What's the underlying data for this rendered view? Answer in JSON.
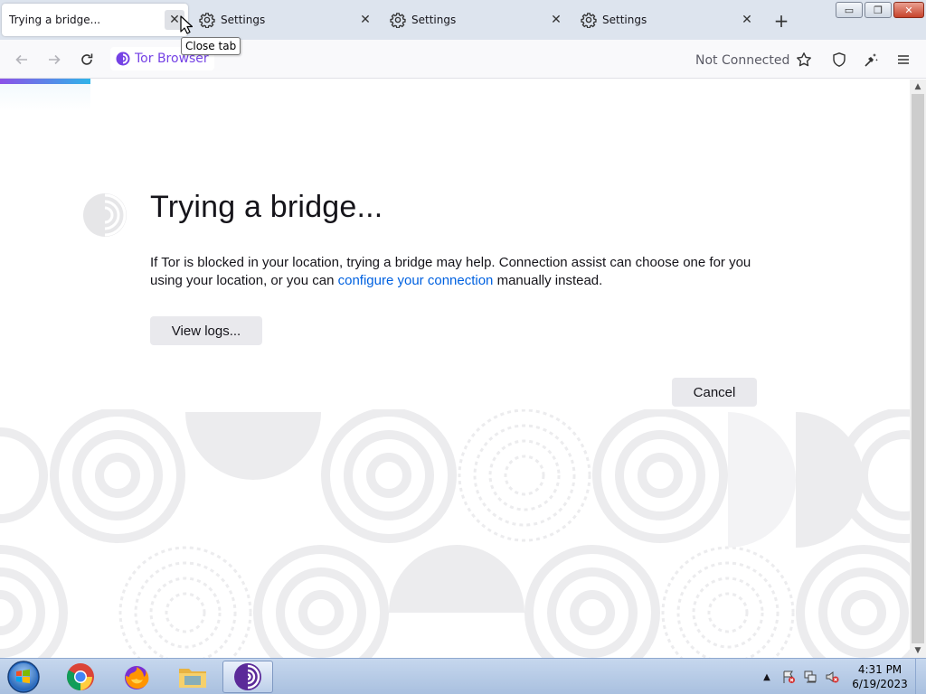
{
  "tabs": [
    {
      "label": "Trying a bridge...",
      "close": "✕"
    },
    {
      "label": "Settings",
      "close": "✕",
      "icon": "gear-icon"
    },
    {
      "label": "Settings",
      "close": "✕",
      "icon": "gear-icon"
    },
    {
      "label": "Settings",
      "close": "✕",
      "icon": "gear-icon"
    }
  ],
  "new_tab": "+",
  "tooltip": "Close tab",
  "window_controls": {
    "minimize": "▭",
    "maximize": "❐",
    "close": "✕"
  },
  "navbar": {
    "identity_label": "Tor Browser",
    "status": "Not Connected"
  },
  "page": {
    "title": "Trying a bridge...",
    "desc_before": "If Tor is blocked in your location, trying a bridge may help. Connection assist can choose one for you using your location, or you can ",
    "desc_link": "configure your connection",
    "desc_after": " manually instead.",
    "view_logs": "View logs...",
    "cancel": "Cancel"
  },
  "scrollbar": {
    "up": "▲",
    "down": "▼"
  },
  "taskbar": {
    "clock_time": "4:31 PM",
    "clock_date": "6/19/2023",
    "tray_chevron": "▲"
  },
  "colors": {
    "accent": "#7542e5",
    "link": "#0061e0",
    "progress_start": "#8c52e8",
    "progress_end": "#2fb4e9"
  }
}
